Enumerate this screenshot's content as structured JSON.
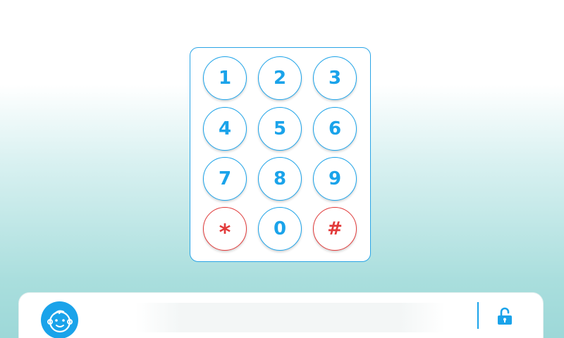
{
  "keypad": {
    "keys": [
      {
        "label": "1",
        "type": "digit"
      },
      {
        "label": "2",
        "type": "digit"
      },
      {
        "label": "3",
        "type": "digit"
      },
      {
        "label": "4",
        "type": "digit"
      },
      {
        "label": "5",
        "type": "digit"
      },
      {
        "label": "6",
        "type": "digit"
      },
      {
        "label": "7",
        "type": "digit"
      },
      {
        "label": "8",
        "type": "digit"
      },
      {
        "label": "9",
        "type": "digit"
      },
      {
        "label": "*",
        "type": "special"
      },
      {
        "label": "0",
        "type": "digit"
      },
      {
        "label": "#",
        "type": "special"
      }
    ]
  },
  "bottom_bar": {
    "avatar_icon": "baby-face-icon",
    "input_value": "",
    "unlock_icon": "unlock-icon"
  },
  "colors": {
    "accent": "#1aa3ea",
    "special": "#e23a3a",
    "background_bottom": "#9dd8d8"
  }
}
